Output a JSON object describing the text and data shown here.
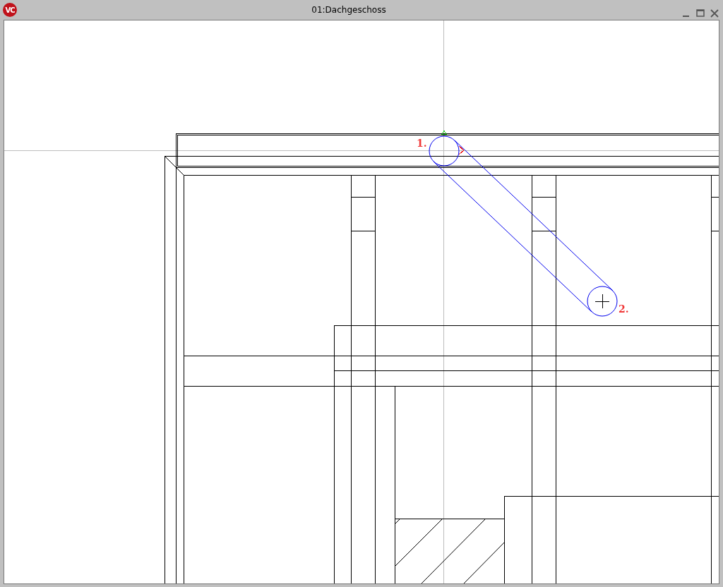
{
  "window": {
    "title": "01:Dachgeschoss",
    "logo": "VC"
  },
  "canvas": {
    "point_labels": [
      "1.",
      "2."
    ]
  }
}
